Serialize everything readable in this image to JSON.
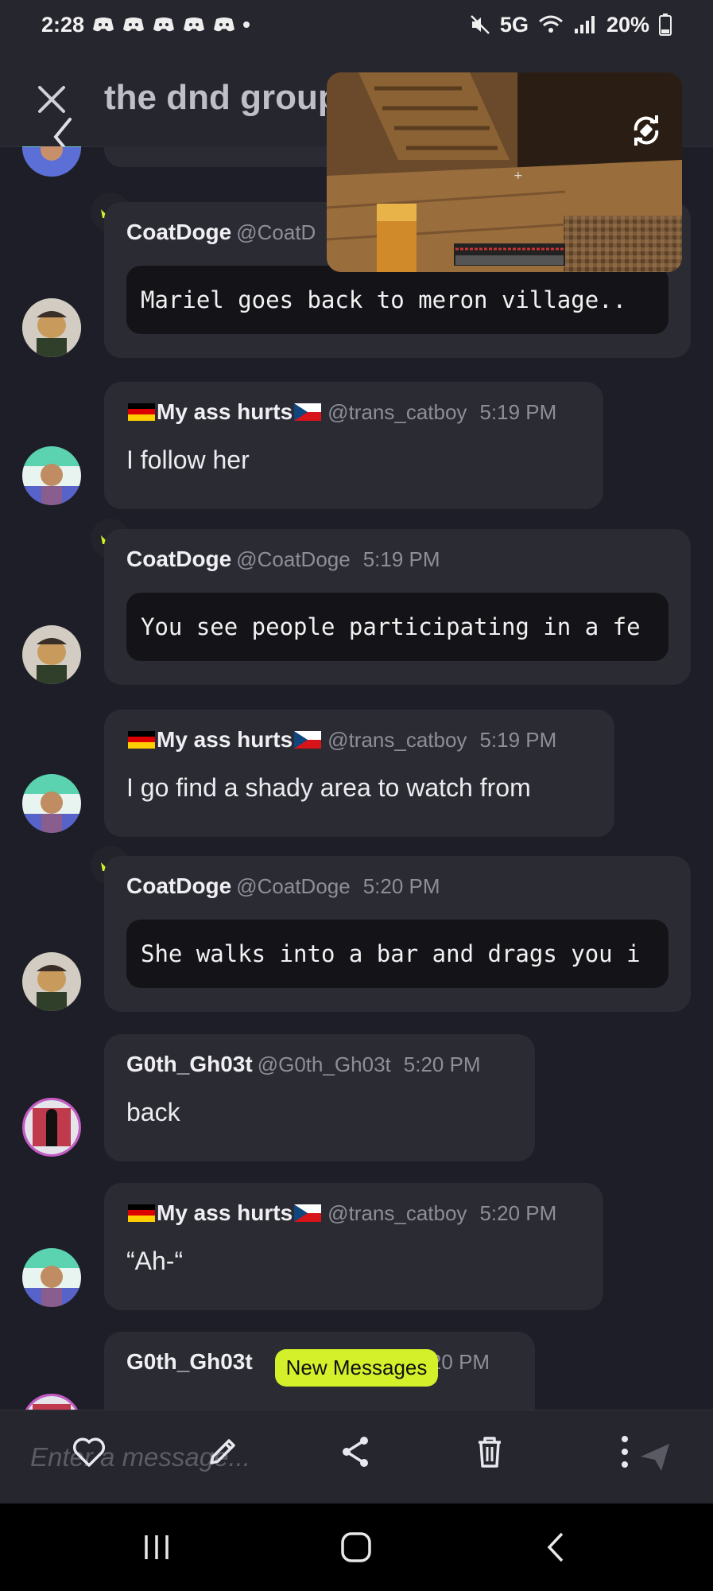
{
  "status_bar": {
    "time": "2:28",
    "network": "5G",
    "battery": "20%"
  },
  "header": {
    "title": "the dnd group"
  },
  "messages": [
    {
      "author": "CoatDoge",
      "handle": "@CoatD",
      "time": "",
      "text": "Mariel goes back to meron village..",
      "style": "code"
    },
    {
      "author": "My ass hurts",
      "handle": "@trans_catboy",
      "time": "5:19 PM",
      "text": "I follow her"
    },
    {
      "author": "CoatDoge",
      "handle": "@CoatDoge",
      "time": "5:19 PM",
      "text": "You see people participating in a fe",
      "style": "code"
    },
    {
      "author": "My ass hurts",
      "handle": "@trans_catboy",
      "time": "5:19 PM",
      "text": "I go find a shady area to watch from"
    },
    {
      "author": "CoatDoge",
      "handle": "@CoatDoge",
      "time": "5:20 PM",
      "text": "She walks into a bar and drags you i",
      "style": "code"
    },
    {
      "author": "G0th_Gh03t",
      "handle": "@G0th_Gh03t",
      "time": "5:20 PM",
      "text": "back"
    },
    {
      "author": "My ass hurts",
      "handle": "@trans_catboy",
      "time": "5:20 PM",
      "text": "“Ah-“"
    },
    {
      "author": "G0th_Gh03t",
      "handle": "",
      "time": ":20 PM",
      "text": ""
    }
  ],
  "new_messages_badge": "New Messages",
  "composer": {
    "placeholder": "Enter a message..."
  },
  "colors": {
    "background": "#1e1e28",
    "bubble": "#2b2b33",
    "accent": "#d4f02a",
    "crown": "#d4f02a"
  }
}
